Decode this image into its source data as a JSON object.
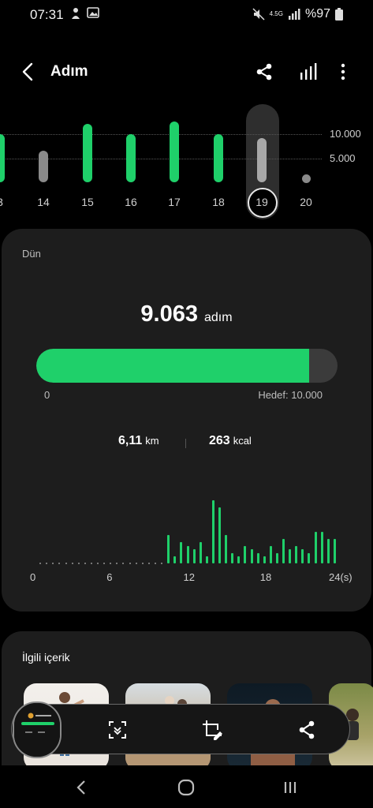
{
  "status": {
    "time": "07:31",
    "network": "4.5G",
    "battery": "%97"
  },
  "header": {
    "title": "Adım"
  },
  "week": {
    "gridlines": [
      "10.000",
      "5.000"
    ],
    "days": [
      {
        "label": "3",
        "value": 9800,
        "state": "goal"
      },
      {
        "label": "14",
        "value": 6500,
        "state": "below"
      },
      {
        "label": "15",
        "value": 12000,
        "state": "goal"
      },
      {
        "label": "16",
        "value": 9800,
        "state": "goal"
      },
      {
        "label": "17",
        "value": 12500,
        "state": "goal"
      },
      {
        "label": "18",
        "value": 9800,
        "state": "goal"
      },
      {
        "label": "19",
        "value": 9063,
        "state": "selected"
      },
      {
        "label": "20",
        "value": 0,
        "state": "none"
      }
    ]
  },
  "card": {
    "subtitle": "Dün",
    "steps": "9.063",
    "steps_unit": "adım",
    "progress_fraction": 0.906,
    "progress_start": "0",
    "goal_label": "Hedef: 10.000",
    "distance": "6,11",
    "distance_unit": "km",
    "calories": "263",
    "calories_unit": "kcal",
    "hourly_axis": [
      "0",
      "6",
      "12",
      "18",
      "24(s)"
    ]
  },
  "chart_data": {
    "type": "bar",
    "x": [
      10.5,
      11,
      11.5,
      12,
      12.5,
      13,
      13.5,
      14,
      14.5,
      15,
      15.5,
      16,
      16.5,
      17,
      17.5,
      18,
      18.5,
      19,
      19.5,
      20,
      20.5,
      21,
      21.5,
      22,
      22.5,
      23,
      23.5
    ],
    "values": [
      8,
      2,
      6,
      5,
      4,
      6,
      2,
      18,
      16,
      8,
      3,
      2,
      5,
      4,
      3,
      2,
      5,
      3,
      7,
      4,
      5,
      4,
      3,
      9,
      9,
      7,
      7
    ],
    "xlim": [
      0,
      24
    ]
  },
  "related": {
    "title": "İlgili içerik"
  },
  "colors": {
    "accent": "#1fd06a",
    "card": "#1d1d1d",
    "muted": "#8a8a8a"
  }
}
